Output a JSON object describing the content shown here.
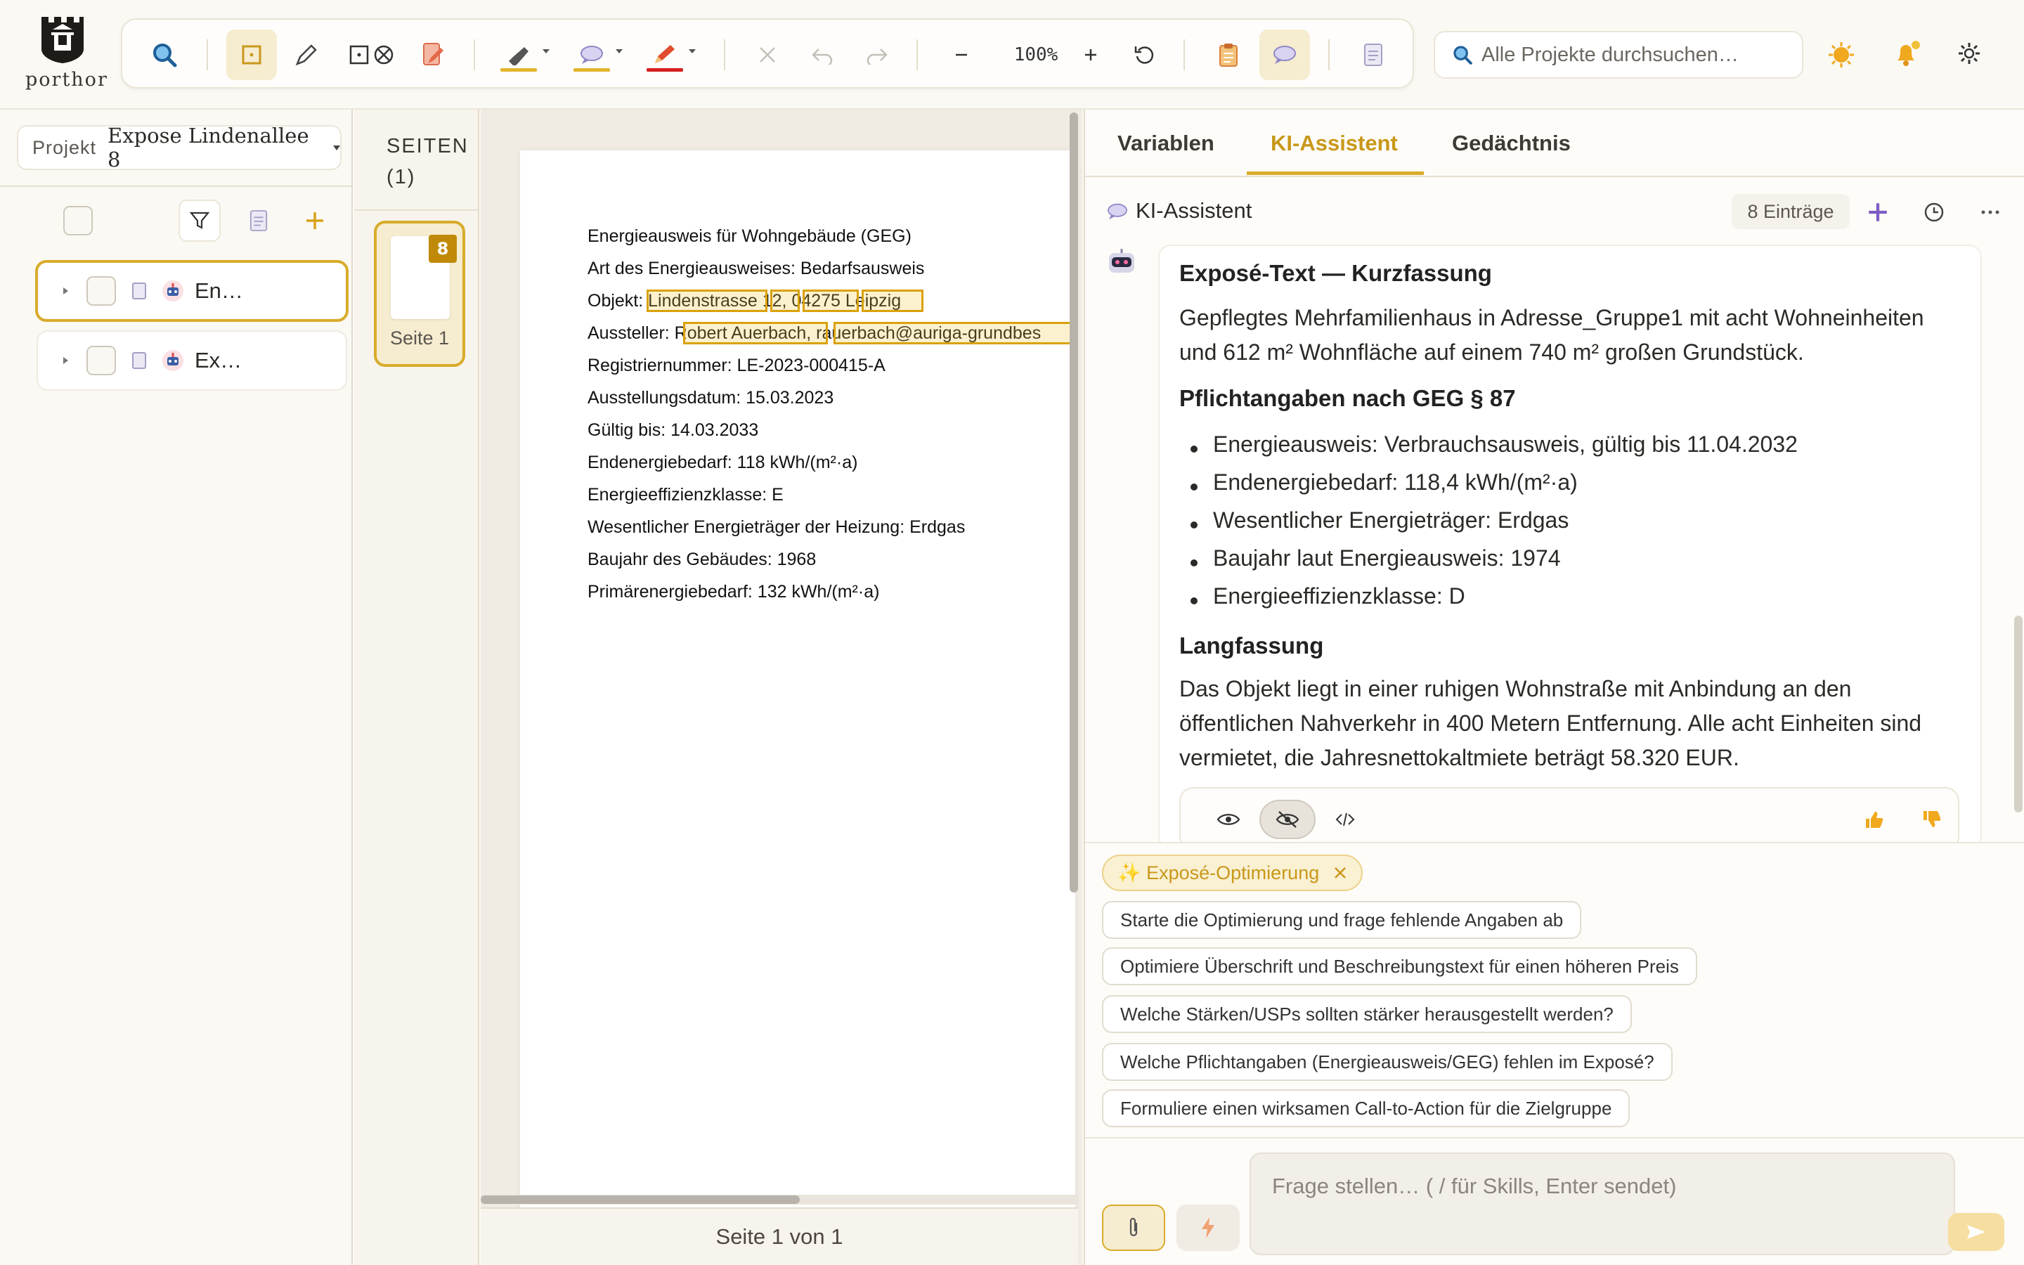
{
  "app": {
    "logo_text": "porthor"
  },
  "toolbar": {
    "zoom": "100%"
  },
  "search": {
    "placeholder": "Alle Projekte durchsuchen…"
  },
  "project": {
    "label": "Projekt",
    "name": "Expose Lindenallee 8"
  },
  "tree": {
    "items": [
      {
        "label": "En…",
        "selected": true
      },
      {
        "label": "Ex…",
        "selected": false
      }
    ]
  },
  "pages": {
    "title": "SEITEN (1)",
    "thumb_label": "Seite 1",
    "badge": "8",
    "indicator": "Seite 1 von 1"
  },
  "document": {
    "lines": [
      "Energieausweis für Wohngebäude (GEG)",
      "Art des Energieausweises: Bedarfsausweis",
      "Objekt: Lindenstrasse 12, 04275 Leipzig",
      "Aussteller: Robert Auerbach, rauerbach@auriga-grundbes",
      "Registriernummer: LE-2023-000415-A",
      "Ausstellungsdatum: 15.03.2023",
      "Gültig bis: 14.03.2033",
      "Endenergiebedarf: 118 kWh/(m²·a)",
      "Energieeffizienzklasse: E",
      "Wesentlicher Energieträger der Heizung: Erdgas",
      "Baujahr des Gebäudes: 1968",
      "Primärenergiebedarf: 132 kWh/(m²·a)"
    ]
  },
  "right_panel": {
    "tabs": [
      "Variablen",
      "KI-Assistent",
      "Gedächtnis"
    ],
    "active_tab": "KI-Assistent",
    "assistant_title": "KI-Assistent",
    "entries_count": "8 Einträge",
    "message": {
      "heading1": "Exposé-Text — Kurzfassung",
      "para1": "Gepflegtes Mehrfamilienhaus in Adresse_Gruppe1 mit acht Wohneinheiten und 612 m² Wohnfläche auf einem 740 m² großen Grundstück.",
      "heading2": "Pflichtangaben nach GEG § 87",
      "bullets": [
        "Energieausweis: Verbrauchsausweis, gültig bis 11.04.2032",
        "Endenergiebedarf: 118,4 kWh/(m²·a)",
        "Wesentlicher Energieträger: Erdgas",
        "Baujahr laut Energieausweis: 1974",
        "Energieeffizienzklasse: D"
      ],
      "heading3": "Langfassung",
      "para2": "Das Objekt liegt in einer ruhigen Wohnstraße mit Anbindung an den öffentlichen Nahverkehr in 400 Metern Entfernung. Alle acht Einheiten sind vermietet, die Jahresnettokaltmiete beträgt 58.320 EUR."
    },
    "skill_chip": "✨ Exposé-Optimierung",
    "suggestions": [
      "Starte die Optimierung und frage fehlende Angaben ab",
      "Optimiere Überschrift und Beschreibungstext für einen höheren Preis",
      "Welche Stärken/USPs sollten stärker herausgestellt werden?",
      "Welche Pflichtangaben (Energieausweis/GEG) fehlen im Exposé?",
      "Formuliere einen wirksamen Call-to-Action für die Zielgruppe"
    ],
    "input_placeholder": "Frage stellen… ( / für Skills, Enter sendet)"
  }
}
